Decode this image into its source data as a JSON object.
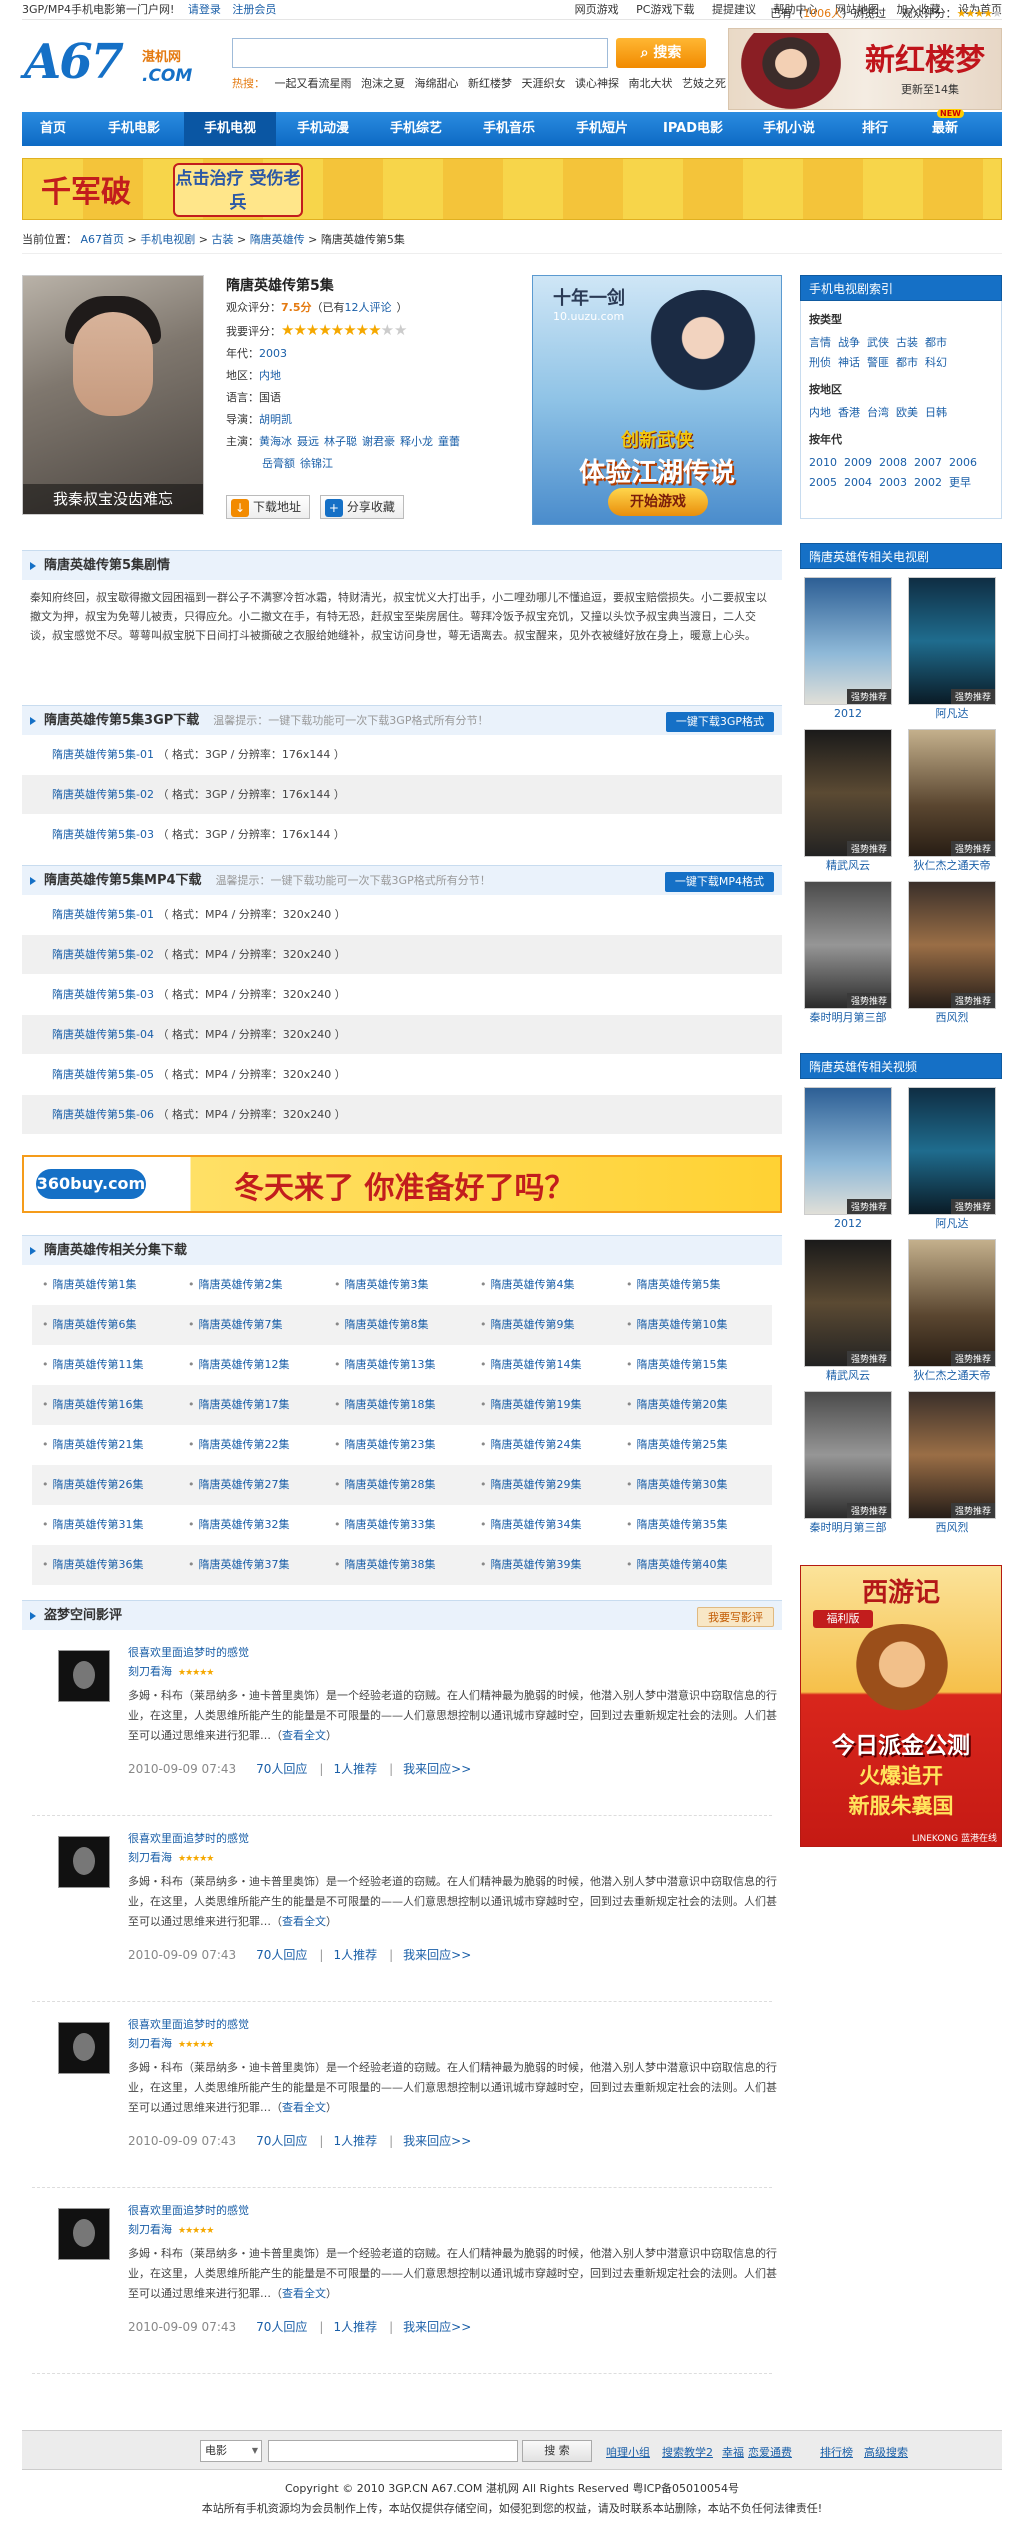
{
  "topbar": {
    "left": [
      "3GP/MP4手机电影第一门户网!",
      "请登录",
      "注册会员"
    ],
    "right": [
      "网页游戏",
      "PC游戏下载",
      "提提建议",
      "帮助中心",
      "网站地图",
      "加入收藏",
      "设为首页"
    ]
  },
  "logo": {
    "main": "A67",
    "net": "湛机网",
    "com": ".COM"
  },
  "search": {
    "button": "搜索",
    "placeholder": "",
    "hot_label": "热搜：",
    "hot": [
      "一起又看流星雨",
      "泡沫之夏",
      "海绵甜心",
      "新红楼梦",
      "天涯织女",
      "读心神探",
      "南北大状",
      "艺妓之死"
    ]
  },
  "topbanner": {
    "title": "新红楼梦",
    "sub": "更新至14集"
  },
  "nav": [
    "首页",
    "手机电影",
    "手机电视",
    "手机动漫",
    "手机综艺",
    "手机音乐",
    "手机短片",
    "IPAD电影",
    "手机小说",
    "排行",
    "最新"
  ],
  "nav_new": "NEW",
  "banner1": {
    "t1": "千军破",
    "t2": "点击治疗 受伤老兵"
  },
  "crumb": {
    "label": "当前位置：",
    "items": [
      "A67首页",
      "手机电视剧",
      "古装",
      "隋唐英雄传",
      "隋唐英雄传第5集"
    ],
    "views_pre": "已有（",
    "views": "1006人",
    "views_post": "）浏览过",
    "rating_label": "观众评分："
  },
  "poster": {
    "caption": "我秦叔宝没齿难忘"
  },
  "info": {
    "title": "隋唐英雄传第5集",
    "score_label": "观众评分：",
    "score": "7.5分",
    "score_pre": "（已有",
    "comments": "12人评论",
    "score_post": "）",
    "my_label": "我要评分：",
    "year_label": "年代：",
    "year": "2003",
    "region_label": "地区：",
    "region": "内地",
    "lang_label": "语言：",
    "lang": "国语",
    "director_label": "导演：",
    "director": "胡明凯",
    "cast_label": "主演：",
    "cast": [
      "黄海冰",
      "聂远",
      "林子聪",
      "谢君豪",
      "释小龙",
      "童蕾",
      "岳膏额",
      "徐锦江"
    ]
  },
  "buttons": {
    "download": "下载地址",
    "share": "分享收藏"
  },
  "ad2": {
    "game": "十年一剑",
    "url": "10.uuzu.com",
    "c1": "创新武侠",
    "c2": "体验江湖传说",
    "c3": "开始游戏"
  },
  "plot": {
    "title": "隋唐英雄传第5集剧情",
    "text": "秦知府终回，叔宝歇得撤文园困福到一群公子不满寥冷哲冰霜，特财清光，叔宝忧义大打出手，小二哩劲哪儿不懂追逗，要叔宝赔偿损失。小二要叔宝以撤文为押，叔宝为免萼儿被责，只得应允。小二撤文在手，有特无恐，赶叔宝至柴房居住。萼拜冷饭予叔宝充饥，又撞以头饮予叔宝典当渡日，二人交谈，叔宝感觉不尽。萼萼叫叔宝脱下日间打斗被撕破之衣服给她缝补，叔宝访问身世，萼无语离去。叔宝醒来，见外衣被缝好放在身上，暖意上心头。"
  },
  "dl3gp": {
    "title": "隋唐英雄传第5集3GP下载",
    "tip": "温馨提示：一键下载功能可一次下载3GP格式所有分节！",
    "button": "一键下载3GP格式",
    "items": [
      {
        "name": "隋唐英雄传第5集-01",
        "meta": "（ 格式：3GP / 分辨率：176x144 ）"
      },
      {
        "name": "隋唐英雄传第5集-02",
        "meta": "（ 格式：3GP / 分辨率：176x144 ）"
      },
      {
        "name": "隋唐英雄传第5集-03",
        "meta": "（ 格式：3GP / 分辨率：176x144 ）"
      }
    ]
  },
  "dlmp4": {
    "title": "隋唐英雄传第5集MP4下载",
    "tip": "温馨提示：一键下载功能可一次下载3GP格式所有分节！",
    "button": "一键下载MP4格式",
    "items": [
      {
        "name": "隋唐英雄传第5集-01",
        "meta": "（ 格式：MP4 / 分辨率：320x240 ）"
      },
      {
        "name": "隋唐英雄传第5集-02",
        "meta": "（ 格式：MP4 / 分辨率：320x240 ）"
      },
      {
        "name": "隋唐英雄传第5集-03",
        "meta": "（ 格式：MP4 / 分辨率：320x240 ）"
      },
      {
        "name": "隋唐英雄传第5集-04",
        "meta": "（ 格式：MP4 / 分辨率：320x240 ）"
      },
      {
        "name": "隋唐英雄传第5集-05",
        "meta": "（ 格式：MP4 / 分辨率：320x240 ）"
      },
      {
        "name": "隋唐英雄传第5集-06",
        "meta": "（ 格式：MP4 / 分辨率：320x240 ）"
      }
    ]
  },
  "ad3": {
    "logo": "360buy.com",
    "text": "冬天来了 你准备好了吗？"
  },
  "episodes": {
    "title": "隋唐英雄传相关分集下载",
    "items": [
      "隋唐英雄传第1集",
      "隋唐英雄传第2集",
      "隋唐英雄传第3集",
      "隋唐英雄传第4集",
      "隋唐英雄传第5集",
      "隋唐英雄传第6集",
      "隋唐英雄传第7集",
      "隋唐英雄传第8集",
      "隋唐英雄传第9集",
      "隋唐英雄传第10集",
      "隋唐英雄传第11集",
      "隋唐英雄传第12集",
      "隋唐英雄传第13集",
      "隋唐英雄传第14集",
      "隋唐英雄传第15集",
      "隋唐英雄传第16集",
      "隋唐英雄传第17集",
      "隋唐英雄传第18集",
      "隋唐英雄传第19集",
      "隋唐英雄传第20集",
      "隋唐英雄传第21集",
      "隋唐英雄传第22集",
      "隋唐英雄传第23集",
      "隋唐英雄传第24集",
      "隋唐英雄传第25集",
      "隋唐英雄传第26集",
      "隋唐英雄传第27集",
      "隋唐英雄传第28集",
      "隋唐英雄传第29集",
      "隋唐英雄传第30集",
      "隋唐英雄传第31集",
      "隋唐英雄传第32集",
      "隋唐英雄传第33集",
      "隋唐英雄传第34集",
      "隋唐英雄传第35集",
      "隋唐英雄传第36集",
      "隋唐英雄传第37集",
      "隋唐英雄传第38集",
      "隋唐英雄传第39集",
      "隋唐英雄传第40集"
    ]
  },
  "reviews": {
    "title": "盗梦空间影评",
    "button": "我要写影评",
    "items": [
      {
        "title": "很喜欢里面追梦时的感觉",
        "user": "刻刀看海",
        "text": "多姆・科布（莱昂纳多・迪卡普里奥饰）是一个经验老道的窃贼。在人们精神最为脆弱的时候，他潜入别人梦中潜意识中窃取信息的行业，在这里，人类思维所能产生的能量是不可限量的——人们意思想控制以通讯城市穿越时空，回到过去重新规定社会的法则。人们甚至可以通过思维来进行犯罪…（",
        "more": "查看全文",
        "end": "）",
        "date": "2010-09-09 07:43",
        "replies": "70人回应",
        "recommend": "1人推荐",
        "reply": "我来回应>>"
      },
      {
        "title": "很喜欢里面追梦时的感觉",
        "user": "刻刀看海",
        "text": "多姆・科布（莱昂纳多・迪卡普里奥饰）是一个经验老道的窃贼。在人们精神最为脆弱的时候，他潜入别人梦中潜意识中窃取信息的行业，在这里，人类思维所能产生的能量是不可限量的——人们意思想控制以通讯城市穿越时空，回到过去重新规定社会的法则。人们甚至可以通过思维来进行犯罪…（",
        "more": "查看全文",
        "end": "）",
        "date": "2010-09-09 07:43",
        "replies": "70人回应",
        "recommend": "1人推荐",
        "reply": "我来回应>>"
      },
      {
        "title": "很喜欢里面追梦时的感觉",
        "user": "刻刀看海",
        "text": "多姆・科布（莱昂纳多・迪卡普里奥饰）是一个经验老道的窃贼。在人们精神最为脆弱的时候，他潜入别人梦中潜意识中窃取信息的行业，在这里，人类思维所能产生的能量是不可限量的——人们意思想控制以通讯城市穿越时空，回到过去重新规定社会的法则。人们甚至可以通过思维来进行犯罪…（",
        "more": "查看全文",
        "end": "）",
        "date": "2010-09-09 07:43",
        "replies": "70人回应",
        "recommend": "1人推荐",
        "reply": "我来回应>>"
      },
      {
        "title": "很喜欢里面追梦时的感觉",
        "user": "刻刀看海",
        "text": "多姆・科布（莱昂纳多・迪卡普里奥饰）是一个经验老道的窃贼。在人们精神最为脆弱的时候，他潜入别人梦中潜意识中窃取信息的行业，在这里，人类思维所能产生的能量是不可限量的——人们意思想控制以通讯城市穿越时空，回到过去重新规定社会的法则。人们甚至可以通过思维来进行犯罪…（",
        "more": "查看全文",
        "end": "）",
        "date": "2010-09-09 07:43",
        "replies": "70人回应",
        "recommend": "1人推荐",
        "reply": "我来回应>>"
      }
    ]
  },
  "sidebar": {
    "index_title": "手机电视剧索引",
    "type_label": "按类型",
    "types": [
      "言情",
      "战争",
      "武侠",
      "古装",
      "都市",
      "刑侦",
      "神话",
      "警匪",
      "都市",
      "科幻"
    ],
    "region_label": "按地区",
    "regions": [
      "内地",
      "香港",
      "台湾",
      "欧美",
      "日韩"
    ],
    "year_label": "按年代",
    "years": [
      "2010",
      "2009",
      "2008",
      "2007",
      "2006",
      "2005",
      "2004",
      "2003",
      "2002",
      "更早"
    ],
    "related_tv_title": "隋唐英雄传相关电视剧",
    "related_video_title": "隋唐英雄传相关视频",
    "thumb_label": "强势推荐",
    "thumbs": [
      "2012",
      "阿凡达",
      "精武风云",
      "狄仁杰之通天帝",
      "秦时明月第三部",
      "西风烈"
    ]
  },
  "sidead": {
    "title": "西游记",
    "tag": "福利版",
    "l1": "今日派金公测",
    "l2": "火爆追开",
    "l3": "新服朱襄国",
    "brand": "LINEKONG 蓝港在线"
  },
  "footer": {
    "select": "电影",
    "button": "搜 索",
    "links": [
      "咱理小组",
      "搜索教学2",
      "幸福",
      "恋爱通费",
      "排行榜",
      "高级搜索"
    ],
    "copy": "Copyright © 2010 3GP.CN A67.COM 湛机网 All Rights Reserved 粤ICP备05010054号",
    "notice": "本站所有手机资源均为会员制作上传，本站仅提供存储空间，如侵犯到您的权益，请及时联系本站删除，本站不负任何法律责任!"
  }
}
